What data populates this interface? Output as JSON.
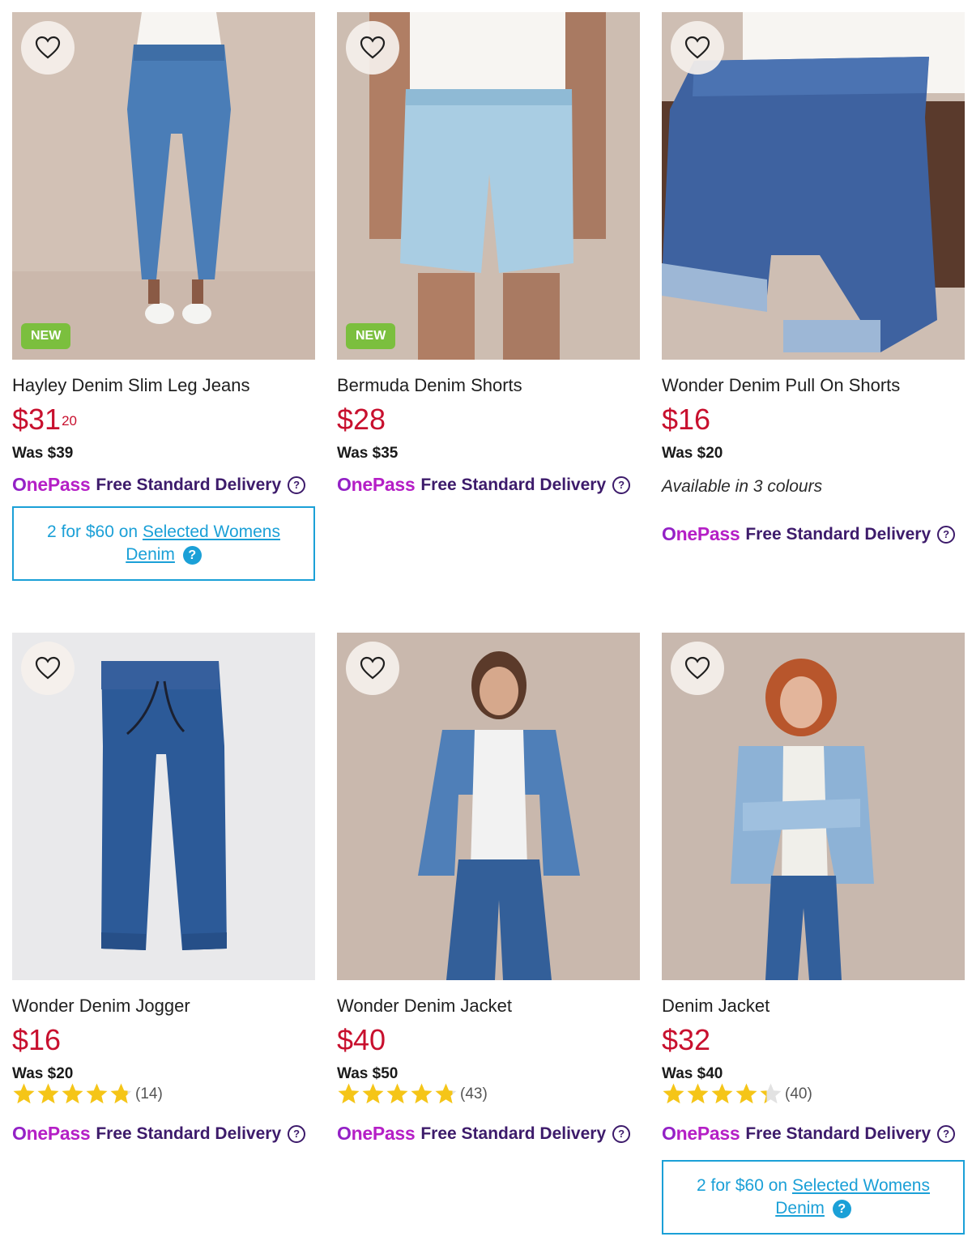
{
  "onepass": {
    "logo": "OnePass",
    "delivery": "Free Standard Delivery",
    "help": "?"
  },
  "products": [
    {
      "name": "Hayley Denim Slim Leg Jeans",
      "price_main": "$31",
      "price_cents": "20",
      "was": "Was $39",
      "badge": "NEW",
      "promo": {
        "prefix": "2 for $60 on",
        "link": "Selected Womens",
        "link2": "Denim"
      }
    },
    {
      "name": "Bermuda Denim Shorts",
      "price_main": "$28",
      "was": "Was $35",
      "badge": "NEW"
    },
    {
      "name": "Wonder Denim Pull On Shorts",
      "price_main": "$16",
      "was": "Was $20",
      "colours": "Available in 3 colours"
    },
    {
      "name": "Wonder Denim Jogger",
      "price_main": "$16",
      "was": "Was $20",
      "rating": 4.8,
      "reviews": "(14)"
    },
    {
      "name": "Wonder Denim Jacket",
      "price_main": "$40",
      "was": "Was $50",
      "rating": 4.8,
      "reviews": "(43)"
    },
    {
      "name": "Denim Jacket",
      "price_main": "$32",
      "was": "Was $40",
      "rating": 4.3,
      "reviews": "(40)",
      "promo": {
        "prefix": "2 for $60 on",
        "link": "Selected Womens",
        "link2": "Denim"
      }
    }
  ],
  "colors": {
    "price": "#c8102e",
    "onepass": "#b51fc6",
    "delivery": "#3d1b6b",
    "promo": "#1ba0d7",
    "badge": "#7bbf3e",
    "star": "#f5c518"
  },
  "icons": {
    "favourite": "heart-outline-icon",
    "star": "star-icon",
    "help": "question-circle-icon"
  }
}
